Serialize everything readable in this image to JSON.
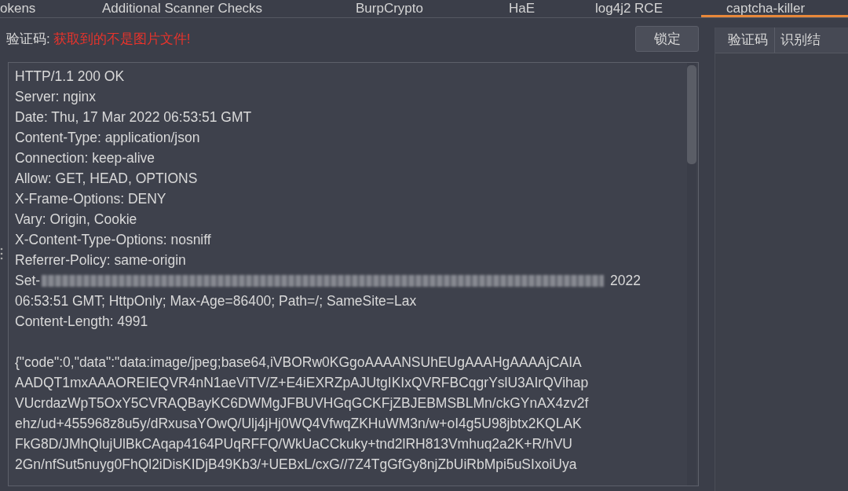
{
  "tabs": [
    {
      "label": "okens",
      "selected": false
    },
    {
      "label": "Additional Scanner Checks",
      "selected": false
    },
    {
      "label": "BurpCrypto",
      "selected": false
    },
    {
      "label": "HaE",
      "selected": false
    },
    {
      "label": "log4j2 RCE",
      "selected": false
    },
    {
      "label": "captcha-killer",
      "selected": true
    }
  ],
  "captcha": {
    "label": "验证码:",
    "message": "获取到的不是图片文件!",
    "lock_button": "锁定"
  },
  "response": {
    "headers": [
      "HTTP/1.1 200 OK",
      "Server: nginx",
      "Date: Thu, 17 Mar 2022 06:53:51 GMT",
      "Content-Type: application/json",
      "Connection: keep-alive",
      "Allow: GET, HEAD, OPTIONS",
      "X-Frame-Options: DENY",
      "Vary: Origin, Cookie",
      "X-Content-Type-Options: nosniff",
      "Referrer-Policy: same-origin"
    ],
    "cookie": {
      "prefix": "Set-",
      "suffix": "2022"
    },
    "after": [
      "06:53:51 GMT; HttpOnly; Max-Age=86400; Path=/; SameSite=Lax",
      "Content-Length: 4991"
    ],
    "body": [
      "{\"code\":0,\"data\":\"data:image/jpeg;base64,iVBORw0KGgoAAAANSUhEUgAAAHgAAAAjCAIA",
      "AADQT1mxAAAOREIEQVR4nN1aeViTV/Z+E4iEXRZpAJUtgIKIxQVRFBCqgrYslU3AIrQVihap",
      "VUcrdazWpT5OxY5CVRAQBayKC6DWMgJFBUVHGqGCKFjZBJEBMSBLMn/ckGYnAX4zv2f",
      "ehz/ud+455968z8u5y/dRxusaYOwQ/Ulj4jHj0WQ4VfwqZKHuWM3n/w+oI4g5U98jbtx2KQLAK",
      "FkG8D/JMhQlujUlBkCAqap4164PUqRFFQ/WkUaCCkuky+tnd2lRH813Vmhuq2a2K+R/hVU",
      "2Gn/nfSut5nuyg0FhQl2iDisKIDjB49Kb3/+UEBxL/cxG//7Z4TgGfGy8njZbUiRbMpi5uSIxoiUya"
    ]
  },
  "results_table": {
    "columns": [
      "验证码",
      "识别结"
    ]
  }
}
